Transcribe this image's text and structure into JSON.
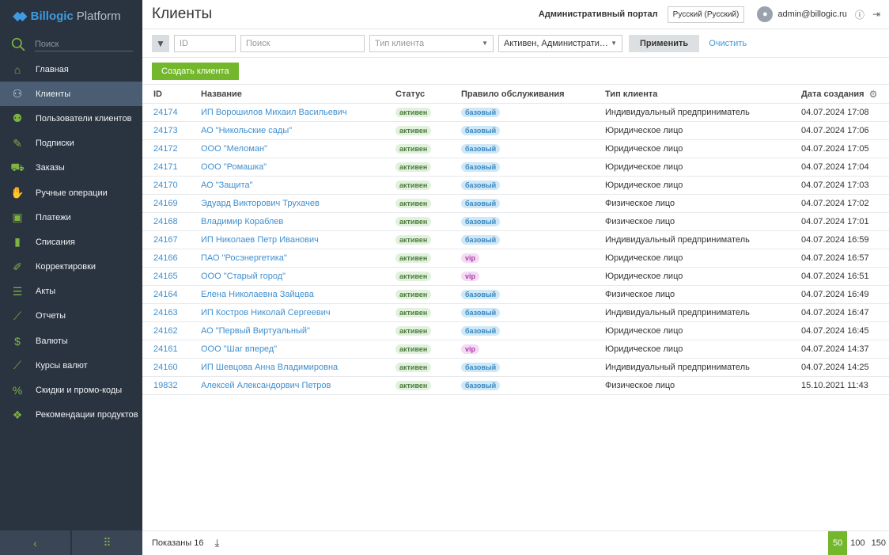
{
  "app": {
    "logo_brand": "Billogic",
    "logo_suffix": "Platform"
  },
  "sidebar": {
    "search_placeholder": "Поиск",
    "items": [
      {
        "label": "Главная",
        "icon": "home-icon",
        "active": false
      },
      {
        "label": "Клиенты",
        "icon": "person-icon",
        "active": true
      },
      {
        "label": "Пользователи клиентов",
        "icon": "users-icon",
        "active": false
      },
      {
        "label": "Подписки",
        "icon": "edit-icon",
        "active": false
      },
      {
        "label": "Заказы",
        "icon": "cart-icon",
        "active": false
      },
      {
        "label": "Ручные операции",
        "icon": "hand-icon",
        "active": false
      },
      {
        "label": "Платежи",
        "icon": "wallet-icon",
        "active": false
      },
      {
        "label": "Списания",
        "icon": "bars-icon",
        "active": false
      },
      {
        "label": "Корректировки",
        "icon": "pencil-icon",
        "active": false
      },
      {
        "label": "Акты",
        "icon": "list-icon",
        "active": false
      },
      {
        "label": "Отчеты",
        "icon": "chart-icon",
        "active": false
      },
      {
        "label": "Валюты",
        "icon": "dollar-icon",
        "active": false
      },
      {
        "label": "Курсы валют",
        "icon": "rate-chart-icon",
        "active": false
      },
      {
        "label": "Скидки и промо-коды",
        "icon": "percent-icon",
        "active": false
      },
      {
        "label": "Рекомендации продуктов",
        "icon": "boxes-icon",
        "active": false
      }
    ]
  },
  "header": {
    "title": "Клиенты",
    "portal": "Административный портал",
    "language": "Русский (Русский)",
    "user": "admin@billogic.ru"
  },
  "toolbar": {
    "id_placeholder": "ID",
    "search_placeholder": "Поиск",
    "type_placeholder": "Тип клиента",
    "status_value": "Активен, Администрати…",
    "apply_label": "Применить",
    "clear_label": "Очистить"
  },
  "create_label": "Создать клиента",
  "table": {
    "columns": {
      "id": "ID",
      "name": "Название",
      "status": "Статус",
      "rule": "Правило обслуживания",
      "type": "Тип клиента",
      "date": "Дата создания"
    },
    "rows": [
      {
        "id": "24174",
        "name": "ИП Ворошилов Михаил Васильевич",
        "status": "активен",
        "rule": "базовый",
        "type": "Индивидуальный предприниматель",
        "date": "04.07.2024 17:08"
      },
      {
        "id": "24173",
        "name": "АО \"Никольские сады\"",
        "status": "активен",
        "rule": "базовый",
        "type": "Юридическое лицо",
        "date": "04.07.2024 17:06"
      },
      {
        "id": "24172",
        "name": "ООО \"Меломан\"",
        "status": "активен",
        "rule": "базовый",
        "type": "Юридическое лицо",
        "date": "04.07.2024 17:05"
      },
      {
        "id": "24171",
        "name": "ООО \"Ромашка\"",
        "status": "активен",
        "rule": "базовый",
        "type": "Юридическое лицо",
        "date": "04.07.2024 17:04"
      },
      {
        "id": "24170",
        "name": "АО \"Защита\"",
        "status": "активен",
        "rule": "базовый",
        "type": "Юридическое лицо",
        "date": "04.07.2024 17:03"
      },
      {
        "id": "24169",
        "name": "Эдуард Викторович Трухачев",
        "status": "активен",
        "rule": "базовый",
        "type": "Физическое лицо",
        "date": "04.07.2024 17:02"
      },
      {
        "id": "24168",
        "name": "Владимир Кораблев",
        "status": "активен",
        "rule": "базовый",
        "type": "Физическое лицо",
        "date": "04.07.2024 17:01"
      },
      {
        "id": "24167",
        "name": "ИП Николаев Петр Иванович",
        "status": "активен",
        "rule": "базовый",
        "type": "Индивидуальный предприниматель",
        "date": "04.07.2024 16:59"
      },
      {
        "id": "24166",
        "name": "ПАО \"Росэнергетика\"",
        "status": "активен",
        "rule": "vip",
        "type": "Юридическое лицо",
        "date": "04.07.2024 16:57"
      },
      {
        "id": "24165",
        "name": "ООО \"Старый город\"",
        "status": "активен",
        "rule": "vip",
        "type": "Юридическое лицо",
        "date": "04.07.2024 16:51"
      },
      {
        "id": "24164",
        "name": "Елена Николаевна Зайцева",
        "status": "активен",
        "rule": "базовый",
        "type": "Физическое лицо",
        "date": "04.07.2024 16:49"
      },
      {
        "id": "24163",
        "name": "ИП Костров Николай Сергеевич",
        "status": "активен",
        "rule": "базовый",
        "type": "Индивидуальный предприниматель",
        "date": "04.07.2024 16:47"
      },
      {
        "id": "24162",
        "name": "АО \"Первый Виртуальный\"",
        "status": "активен",
        "rule": "базовый",
        "type": "Юридическое лицо",
        "date": "04.07.2024 16:45"
      },
      {
        "id": "24161",
        "name": "ООО \"Шаг вперед\"",
        "status": "активен",
        "rule": "vip",
        "type": "Юридическое лицо",
        "date": "04.07.2024 14:37"
      },
      {
        "id": "24160",
        "name": "ИП Шевцова Анна Владимировна",
        "status": "активен",
        "rule": "базовый",
        "type": "Индивидуальный предприниматель",
        "date": "04.07.2024 14:25"
      },
      {
        "id": "19832",
        "name": "Алексей Александорвич Петров",
        "status": "активен",
        "rule": "базовый",
        "type": "Физическое лицо",
        "date": "15.10.2021 11:43"
      }
    ]
  },
  "footer": {
    "shown": "Показаны 16",
    "page_sizes": [
      "50",
      "100",
      "150"
    ],
    "selected_page_size": "50"
  },
  "colors": {
    "accent_green": "#73b82c",
    "link_blue": "#3f8fd0",
    "sidebar_bg": "#2a3340"
  }
}
